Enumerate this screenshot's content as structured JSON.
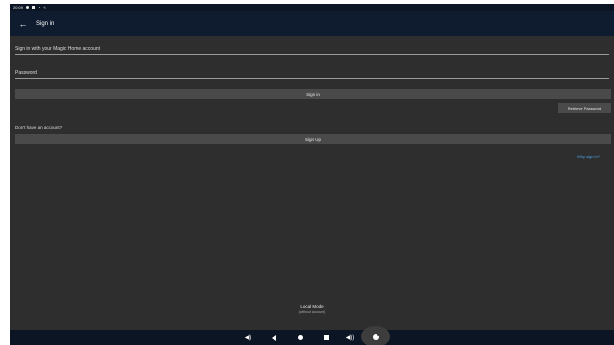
{
  "status_bar": {
    "time": "20:09",
    "icons": [
      "circle-icon",
      "sd-card-icon",
      "wifi-icon",
      "charging-icon"
    ]
  },
  "app_bar": {
    "back_icon": "arrow-left-icon",
    "title": "Sign in"
  },
  "form": {
    "account_placeholder": "Sign in with your Magic Home account",
    "password_placeholder": "Password",
    "sign_in_label": "Sign in",
    "retrieve_password_label": "Retrieve Password",
    "no_account_text": "Don't have an account?",
    "sign_up_label": "Sign Up",
    "why_sign_in_link": "Why sign in?"
  },
  "local_mode": {
    "title": "Local Mode",
    "subtitle": "(without account)"
  },
  "nav_bar": {
    "icons": [
      "volume-down-icon",
      "back-icon",
      "home-icon",
      "recents-icon",
      "volume-up-icon",
      "assistant-icon"
    ]
  },
  "colors": {
    "background": "#2e2e2e",
    "app_bar": "#0f1b2e",
    "button": "#4a4a4a",
    "link": "#4aa3e8"
  }
}
